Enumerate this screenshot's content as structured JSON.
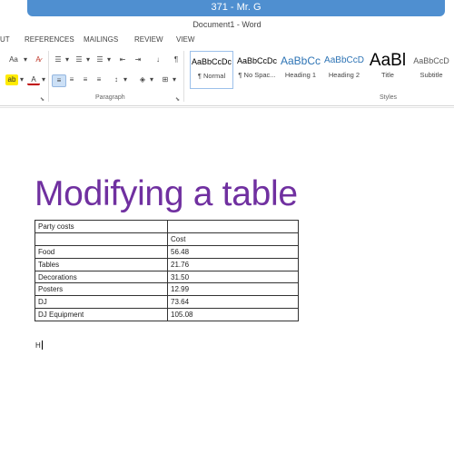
{
  "video": {
    "title": "371 - Mr. G"
  },
  "window": {
    "title": "Document1 - Word"
  },
  "tabs": [
    "UT",
    "REFERENCES",
    "MAILINGS",
    "REVIEW",
    "VIEW"
  ],
  "ribbon": {
    "font_case_label": "Aa",
    "groups": {
      "paragraph": "Paragraph",
      "styles": "Styles"
    }
  },
  "styles": [
    {
      "sample": "AaBbCcDc",
      "name": "¶ Normal",
      "color": "#1f1f1f"
    },
    {
      "sample": "AaBbCcDc",
      "name": "¶ No Spac...",
      "color": "#1f1f1f"
    },
    {
      "sample": "AaBbCc",
      "name": "Heading 1",
      "color": "#2e74b5"
    },
    {
      "sample": "AaBbCcD",
      "name": "Heading 2",
      "color": "#2e74b5"
    },
    {
      "sample": "AaBl",
      "name": "Title",
      "color": "#1f1f1f"
    },
    {
      "sample": "AaBbCcD",
      "name": "Subtitle",
      "color": "#5a5a5a"
    }
  ],
  "document": {
    "heading": "Modifying a table",
    "heading_color": "#7030a0",
    "table": [
      [
        "Party costs",
        ""
      ],
      [
        "",
        "Cost"
      ],
      [
        "Food",
        "56.48"
      ],
      [
        "Tables",
        "21.76"
      ],
      [
        "Decorations",
        "31.50"
      ],
      [
        "Posters",
        "12.99"
      ],
      [
        "DJ",
        "73.64"
      ],
      [
        "DJ Equipment",
        "105.08"
      ]
    ],
    "typed_text": "H"
  }
}
